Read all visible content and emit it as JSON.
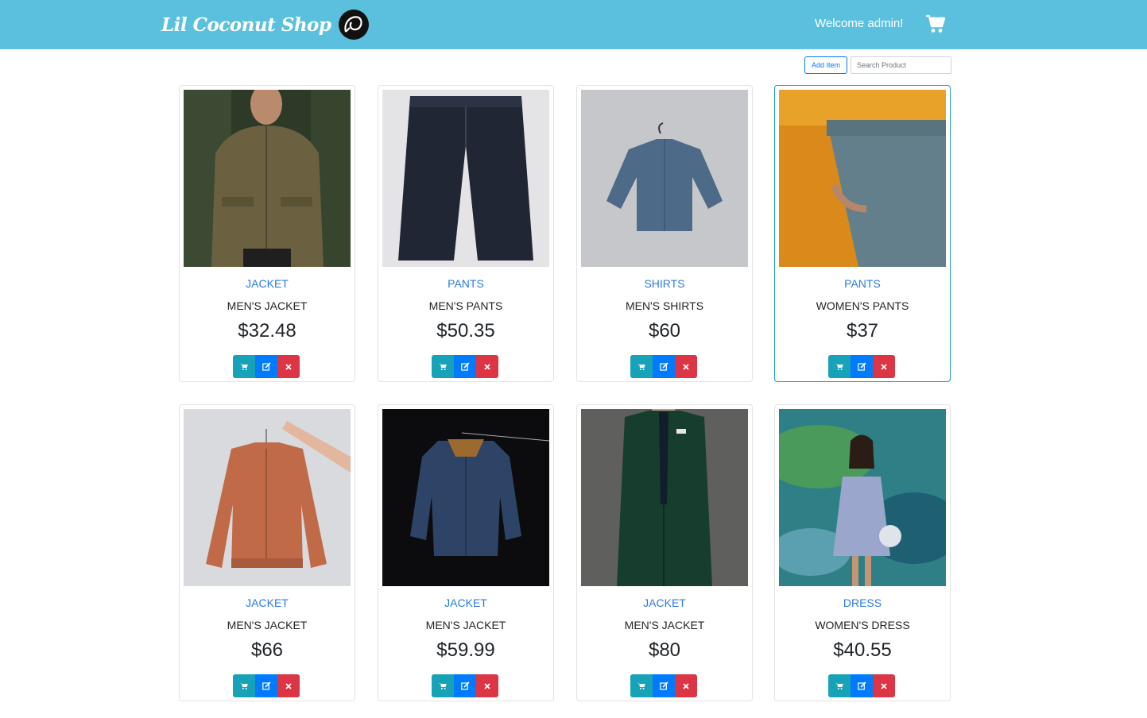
{
  "header": {
    "brand": "Lil Coconut Shop",
    "welcome": "Welcome admin!",
    "background": "#5bc0de"
  },
  "toolbar": {
    "add_label": "Add Item",
    "search_placeholder": "Search Product"
  },
  "icons": {
    "cart": "shopping-cart-icon",
    "edit": "edit-icon",
    "delete": "times-icon"
  },
  "products": [
    {
      "category": "JACKET",
      "name": "MEN'S JACKET",
      "price": "$32.48",
      "image": "olive jacket on man"
    },
    {
      "category": "PANTS",
      "name": "MEN'S PANTS",
      "price": "$50.35",
      "image": "dark jeans on white cloth"
    },
    {
      "category": "SHIRTS",
      "name": "MEN'S SHIRTS",
      "price": "$60",
      "image": "blue patterned shirt on hanger"
    },
    {
      "category": "PANTS",
      "name": "WOMEN'S PANTS",
      "price": "$37",
      "image": "grey sweatpants pocket"
    },
    {
      "category": "JACKET",
      "name": "MEN'S JACKET",
      "price": "$66",
      "image": "rust bomber jacket held up"
    },
    {
      "category": "JACKET",
      "name": "MEN'S JACKET",
      "price": "$59.99",
      "image": "denim jacket on hanger"
    },
    {
      "category": "JACKET",
      "name": "MEN'S JACKET",
      "price": "$80",
      "image": "green suit on man"
    },
    {
      "category": "DRESS",
      "name": "WOMEN'S DRESS",
      "price": "$40.55",
      "image": "woman in floral dress"
    }
  ],
  "colors": {
    "category_link": "#2a7ae2",
    "cart_button": "#17a2b8",
    "edit_button": "#007bff",
    "delete_button": "#dc3545",
    "active_border": "#17a2b8"
  }
}
